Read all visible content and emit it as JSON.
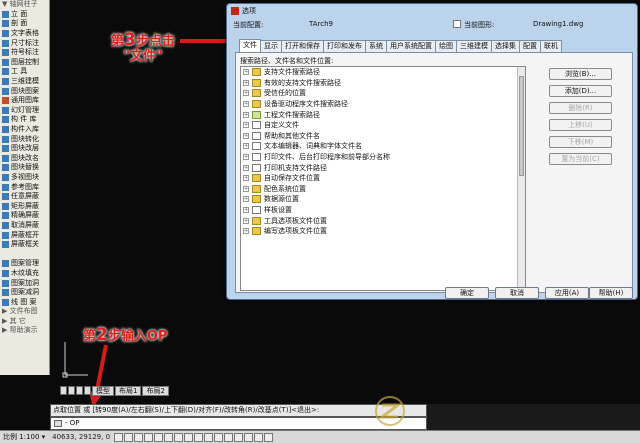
{
  "palette": {
    "items": [
      {
        "label": "▼ 轴网柱子",
        "kind": "hdr",
        "color": "#555555"
      },
      {
        "label": "立 面",
        "kind": "item",
        "color": "#3c7ab8"
      },
      {
        "label": "剖 面",
        "kind": "item",
        "color": "#3c7ab8"
      },
      {
        "label": "文字表格",
        "kind": "item",
        "color": "#3c7ab8"
      },
      {
        "label": "尺寸标注",
        "kind": "item",
        "color": "#3c7ab8"
      },
      {
        "label": "符号标注",
        "kind": "item",
        "color": "#3c7ab8"
      },
      {
        "label": "图层控制",
        "kind": "item",
        "color": "#3c7ab8"
      },
      {
        "label": "工 具",
        "kind": "item",
        "color": "#3c7ab8"
      },
      {
        "label": "三维建模",
        "kind": "item",
        "color": "#3c7ab8"
      },
      {
        "label": "图块图案",
        "kind": "item",
        "color": "#3c7ab8"
      },
      {
        "label": "通用图库",
        "kind": "item",
        "color": "#c24f2a"
      },
      {
        "label": "幻灯管理",
        "kind": "item",
        "color": "#3c7ab8"
      },
      {
        "label": "构 件 库",
        "kind": "item",
        "color": "#3c7ab8"
      },
      {
        "label": "构件入库",
        "kind": "item",
        "color": "#3c7ab8"
      },
      {
        "label": "图块转化",
        "kind": "item",
        "color": "#3c7ab8"
      },
      {
        "label": "图块改层",
        "kind": "item",
        "color": "#3c7ab8"
      },
      {
        "label": "图块改名",
        "kind": "item",
        "color": "#3c7ab8"
      },
      {
        "label": "图块替换",
        "kind": "item",
        "color": "#3c7ab8"
      },
      {
        "label": "多视图块",
        "kind": "item",
        "color": "#3c7ab8"
      },
      {
        "label": "参考图库",
        "kind": "item",
        "color": "#3c7ab8"
      },
      {
        "label": "任意屏蔽",
        "kind": "item",
        "color": "#3c7ab8"
      },
      {
        "label": "矩形屏蔽",
        "kind": "item",
        "color": "#3c7ab8"
      },
      {
        "label": "精确屏蔽",
        "kind": "item",
        "color": "#3c7ab8"
      },
      {
        "label": "取消屏蔽",
        "kind": "item",
        "color": "#3c7ab8"
      },
      {
        "label": "屏蔽框开",
        "kind": "item",
        "color": "#3c7ab8"
      },
      {
        "label": "屏蔽框关",
        "kind": "item",
        "color": "#3c7ab8"
      },
      {
        "label": "",
        "kind": "gap",
        "color": ""
      },
      {
        "label": "图案管理",
        "kind": "item",
        "color": "#3c7ab8"
      },
      {
        "label": "木纹填充",
        "kind": "item",
        "color": "#3c7ab8"
      },
      {
        "label": "图案加洞",
        "kind": "item",
        "color": "#3c7ab8"
      },
      {
        "label": "图案减洞",
        "kind": "item",
        "color": "#3c7ab8"
      },
      {
        "label": "线 图 案",
        "kind": "item",
        "color": "#3c7ab8"
      },
      {
        "label": "▶ 文件布图",
        "kind": "hdr",
        "color": "#555555"
      },
      {
        "label": "▶ 其 它",
        "kind": "hdr",
        "color": "#555555"
      },
      {
        "label": "▶ 帮助演示",
        "kind": "hdr",
        "color": "#555555"
      }
    ]
  },
  "annotations": {
    "step3_prefix": "第",
    "step3_num": "3",
    "step3_text": "步点击",
    "step3_quote": "\"文件\"",
    "step2_prefix": "第",
    "step2_num": "2",
    "step2_text": "步输入OP"
  },
  "layout_tabs": [
    "模型",
    "布局1",
    "布局2"
  ],
  "command": {
    "history": "点取位置 或 [转90度(A)/左右翻(S)/上下翻(D)/对齐(F)/改转角(R)/改基点(T)]<退出>:",
    "input": "- OP"
  },
  "status": {
    "scale": "比例 1:100 ▾",
    "coords": "40633, 29129, 0"
  },
  "dialog": {
    "title": "选项",
    "current_profile_label": "当前配置:",
    "current_profile_value": "TArch9",
    "current_drawing_label": "当前图形:",
    "current_drawing_value": "Drawing1.dwg",
    "tabs": [
      "文件",
      "显示",
      "打开和保存",
      "打印和发布",
      "系统",
      "用户系统配置",
      "绘图",
      "三维建模",
      "选择集",
      "配置",
      "联机"
    ],
    "tree_label": "搜索路径、文件名和文件位置:",
    "tree_items": [
      {
        "label": "支持文件搜索路径",
        "icon": "folder"
      },
      {
        "label": "有效的支持文件搜索路径",
        "icon": "folder"
      },
      {
        "label": "受信任的位置",
        "icon": "folder"
      },
      {
        "label": "设备驱动程序文件搜索路径",
        "icon": "folder"
      },
      {
        "label": "工程文件搜索路径",
        "icon": "dir"
      },
      {
        "label": "自定义文件",
        "icon": "doc"
      },
      {
        "label": "帮助和其他文件名",
        "icon": "doc"
      },
      {
        "label": "文本编辑器、词典和字体文件名",
        "icon": "doc"
      },
      {
        "label": "打印文件、后台打印程序和前导部分名称",
        "icon": "doc"
      },
      {
        "label": "打印机支持文件路径",
        "icon": "doc"
      },
      {
        "label": "自动保存文件位置",
        "icon": "folder"
      },
      {
        "label": "配色系统位置",
        "icon": "folder"
      },
      {
        "label": "数据源位置",
        "icon": "folder"
      },
      {
        "label": "样板设置",
        "icon": "doc"
      },
      {
        "label": "工具选项板文件位置",
        "icon": "folder"
      },
      {
        "label": "编写选项板文件位置",
        "icon": "folder"
      }
    ],
    "side_buttons": [
      {
        "label": "浏览(B)...",
        "enabled": true
      },
      {
        "label": "添加(D)...",
        "enabled": true
      },
      {
        "label": "删除(R)",
        "enabled": false
      },
      {
        "label": "上移(U)",
        "enabled": false
      },
      {
        "label": "下移(M)",
        "enabled": false
      },
      {
        "label": "置为当前(C)",
        "enabled": false
      }
    ],
    "footer_buttons": [
      "确定",
      "取消",
      "应用(A)",
      "帮助(H)"
    ]
  },
  "colors": {
    "annotation_red": "#e0201c",
    "dialog_frame": "#bcd3ec",
    "canvas": "#0a0a0a"
  }
}
